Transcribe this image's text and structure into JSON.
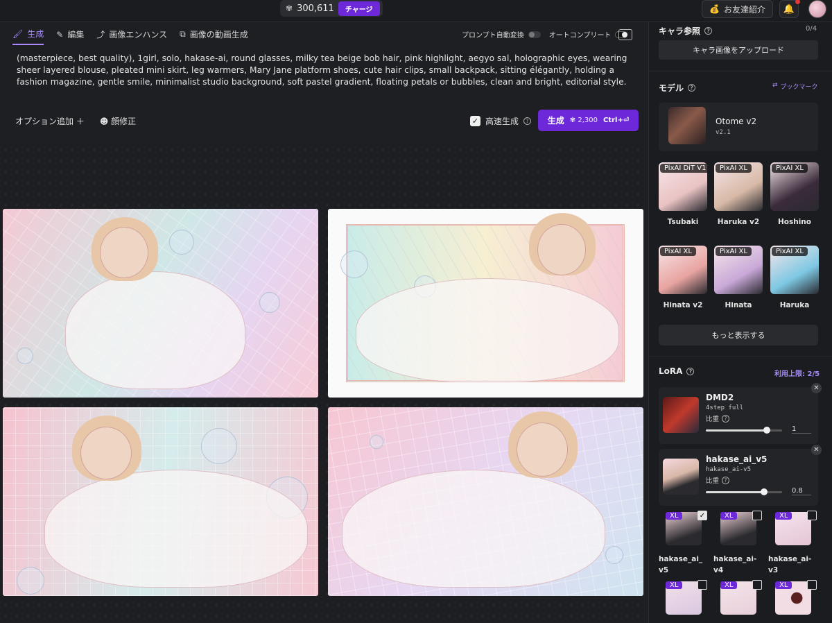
{
  "topbar": {
    "credits": "300,611",
    "charge_label": "チャージ",
    "invite_label": "お友達紹介"
  },
  "tabs": [
    {
      "label": "生成",
      "icon": "brush-icon"
    },
    {
      "label": "編集",
      "icon": "pencil-icon"
    },
    {
      "label": "画像エンハンス",
      "icon": "enhance-icon"
    },
    {
      "label": "画像の動画生成",
      "icon": "video-icon"
    }
  ],
  "toggles": {
    "prompt_auto": "プロンプト自動変換",
    "autocomplete": "オートコンプリート"
  },
  "prompt_text": "(masterpiece, best quality), 1girl, solo, hakase-ai, round glasses, milky tea beige bob hair, pink highlight, aegyo sal, holographic eyes, wearing sheer layered blouse, pleated mini skirt, leg warmers, Mary Jane platform shoes, cute hair clips, small backpack, sitting élégantly, holding a fashion magazine, gentle smile, minimalist studio background, soft pastel gradient, floating petals or bubbles, clean and bright, editorial style.",
  "options": {
    "add_option": "オプション追加 ＋",
    "face_fix": "顔修正",
    "fast_gen": "高速生成"
  },
  "generate": {
    "label": "生成",
    "cost": "2,300",
    "shortcut": "Ctrl+⏎"
  },
  "sidebar": {
    "char_ref": {
      "title": "キャラ参照",
      "count": "0/4",
      "upload": "キャラ画像をアップロード"
    },
    "model": {
      "title": "モデル",
      "bookmark": "ブックマーク",
      "current_name": "Otome v2",
      "current_version": "v2.1",
      "grid": [
        {
          "badge": "PixAI DiT V1",
          "name": "Tsubaki",
          "color": "#e9c3c3"
        },
        {
          "badge": "PixAI XL",
          "name": "Haruka v2",
          "color": "#d7b9a6"
        },
        {
          "badge": "PixAI XL",
          "name": "Hoshino",
          "color": "#3b2b3b"
        },
        {
          "badge": "PixAI XL",
          "name": "Hinata v2",
          "color": "#e8a4a0"
        },
        {
          "badge": "PixAI XL",
          "name": "Hinata",
          "color": "#c9a9d8"
        },
        {
          "badge": "PixAI XL",
          "name": "Haruka",
          "color": "#7ec8e3"
        }
      ],
      "more": "もっと表示する"
    },
    "lora": {
      "title": "LoRA",
      "limit": "利用上限: 2/5",
      "items": [
        {
          "name": "DMD2",
          "sub": "4step full",
          "weight_label": "比重",
          "value": "1",
          "fraction": 0.8
        },
        {
          "name": "hakase_ai_v5",
          "sub": "hakase_ai-v5",
          "weight_label": "比重",
          "value": "0.8",
          "fraction": 0.76
        }
      ],
      "versions": [
        {
          "badge": "XL",
          "name": "hakase_ai_v5",
          "checked": true
        },
        {
          "badge": "XL",
          "name": "hakase_ai-v4",
          "checked": false
        },
        {
          "badge": "XL",
          "name": "hakase_ai-v3",
          "checked": false
        },
        {
          "badge": "XL",
          "name": "",
          "checked": false
        },
        {
          "badge": "XL",
          "name": "",
          "checked": false
        },
        {
          "badge": "XL",
          "name": "",
          "checked": false
        }
      ]
    }
  }
}
